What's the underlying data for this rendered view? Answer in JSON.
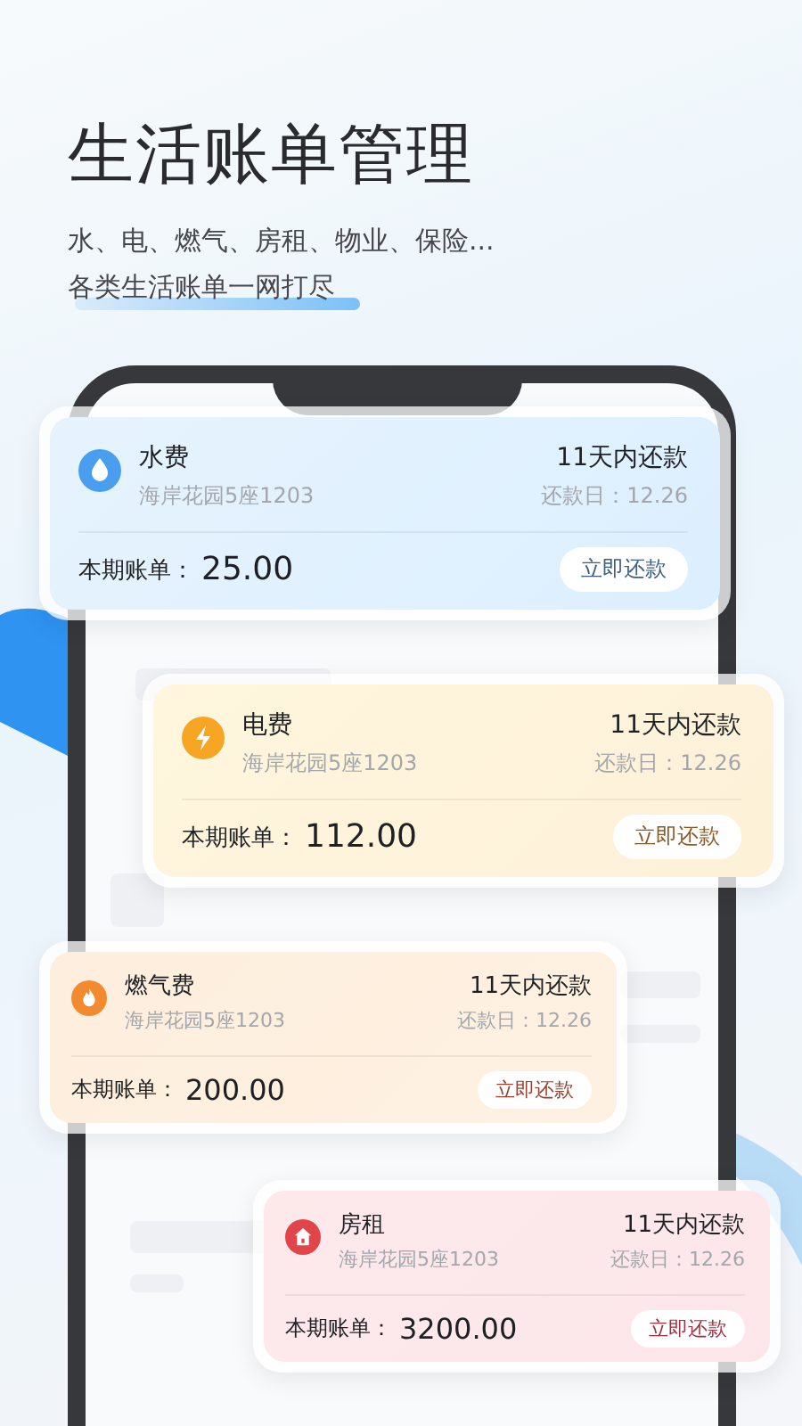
{
  "headline": "生活账单管理",
  "subtitle_lines": [
    {
      "text": "水、电、燃气、房租、物业、保险...",
      "highlighted": false
    },
    {
      "text": "各类生活账单一网打尽",
      "highlighted": true
    }
  ],
  "bills": [
    {
      "kind": "water",
      "name": "水费",
      "address": "海岸花园5座1203",
      "due_in": "11天内还款",
      "due_date": "还款日：12.26",
      "amount_label": "本期账单：",
      "amount": "25.00",
      "button": "立即还款"
    },
    {
      "kind": "electricity",
      "name": "电费",
      "address": "海岸花园5座1203",
      "due_in": "11天内还款",
      "due_date": "还款日：12.26",
      "amount_label": "本期账单：",
      "amount": "112.00",
      "button": "立即还款"
    },
    {
      "kind": "gas",
      "name": "燃气费",
      "address": "海岸花园5座1203",
      "due_in": "11天内还款",
      "due_date": "还款日：12.26",
      "amount_label": "本期账单：",
      "amount": "200.00",
      "button": "立即还款"
    },
    {
      "kind": "rent",
      "name": "房租",
      "address": "海岸花园5座1203",
      "due_in": "11天内还款",
      "due_date": "还款日：12.26",
      "amount_label": "本期账单：",
      "amount": "3200.00",
      "button": "立即还款"
    }
  ]
}
